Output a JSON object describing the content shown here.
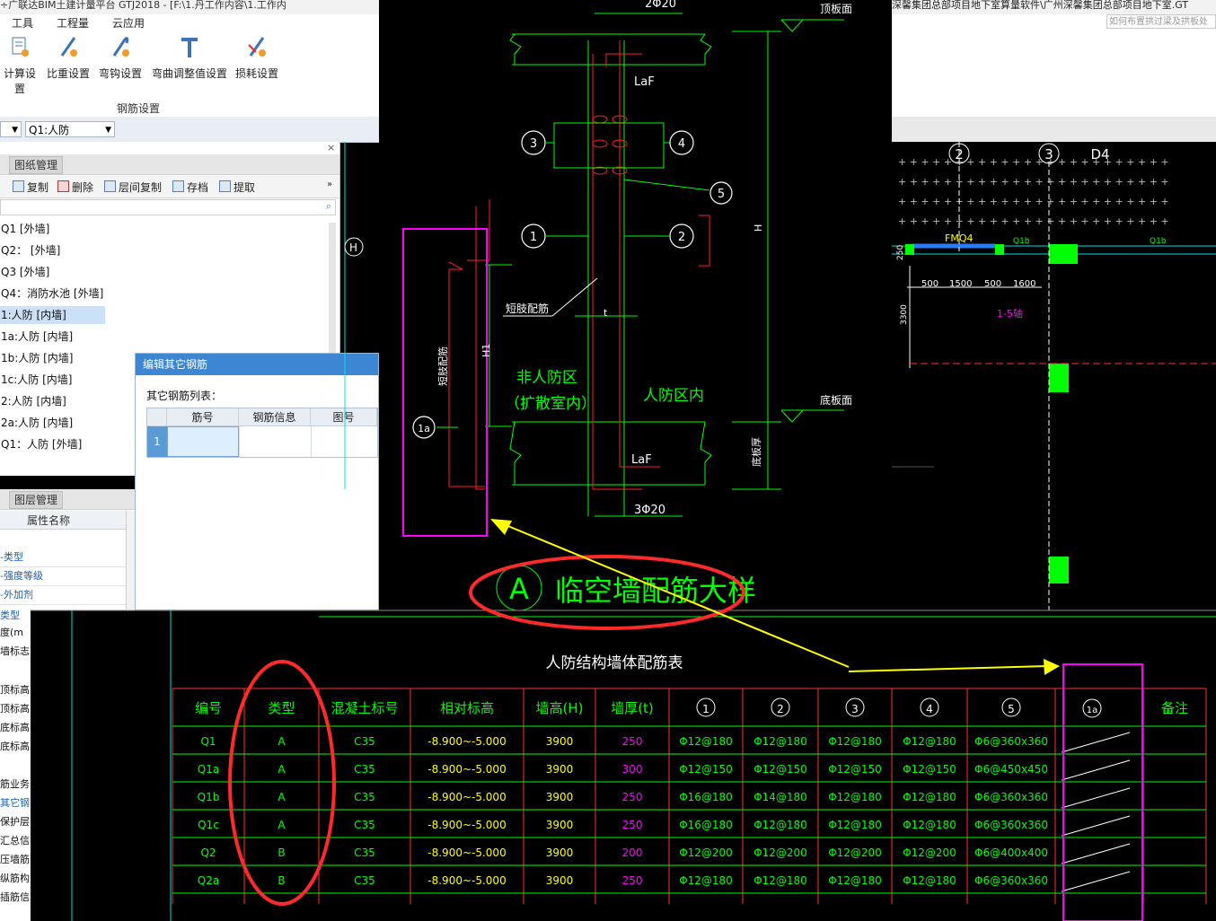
{
  "left_app": {
    "title": "÷广联达BIM土建计量平台 GTJ2018 - [F:\\1.丹工作内容\\1.工作内",
    "menu": [
      "工具",
      "工程量",
      "云应用"
    ],
    "ribbon_buttons": [
      "计算设置",
      "比重设置",
      "弯钩设置",
      "弯曲调整值设置",
      "损耗设置"
    ],
    "ribbon_group": "钢筋设置",
    "combo_value": "Q1:人防",
    "drawing_tab": "图纸管理",
    "tools": [
      "复制",
      "删除",
      "层间复制",
      "存档",
      "提取"
    ],
    "tree_items": [
      "Q1 [外墙]",
      "Q2： [外墙]",
      "Q3 [外墙]",
      "Q4：消防水池 [外墙]",
      "1:人防 [内墙]",
      "1a:人防 [内墙]",
      "1b:人防 [内墙]",
      "1c:人防 [内墙]",
      "2:人防 [内墙]",
      "2a:人防 [内墙]",
      "Q1：人防 [外墙]"
    ],
    "layer_tab": "图层管理",
    "prop_header": "属性名称",
    "prop_rows": [
      "-类型",
      "-强度等级",
      "-外加剂",
      "类型"
    ],
    "side_labels": [
      "度(m",
      "墙标志",
      "",
      "顶标高(",
      "顶标高(",
      "底标高(",
      "底标高(",
      "",
      "筋业务",
      "其它钢",
      "保护层",
      "汇总信",
      "压墙筋",
      "纵筋构",
      "插筋信"
    ]
  },
  "dialog": {
    "title": "编辑其它钢筋",
    "list_label": "其它钢筋列表：",
    "columns": [
      "筋号",
      "钢筋信息",
      "图号"
    ],
    "row_number": "1"
  },
  "right_app": {
    "title": "深馨集团总部项目地下室算量软件\\广州深馨集团总部项目地下室.GT",
    "search_placeholder": "如何布置拱过梁及拱板处"
  },
  "cad_detail": {
    "top_bar": "2Φ20",
    "bottom_bar": "3Φ20",
    "laf_top": "LaF",
    "laf_bottom": "LaF",
    "roof_label": "顶板面",
    "floor_label": "底板面",
    "short_bar": "短肢配筋",
    "left_rebar": "短肢配筋",
    "zone_non1": "非人防区",
    "zone_non2": "（扩散室内）",
    "zone_civil": "人防区内",
    "thickness": "t",
    "height": "H",
    "h1": "H1",
    "floor_thickness": "底板厚",
    "markers": [
      "1",
      "2",
      "3",
      "4",
      "5",
      "1a"
    ],
    "detail_letter": "A",
    "detail_title": "临空墙配筋大样"
  },
  "cad_plan": {
    "grid": [
      "2",
      "3",
      "D4"
    ],
    "door": "FMQ4",
    "q1b_1": "Q1b",
    "q1b_2": "Q1b",
    "dims": [
      "500",
      "1500",
      "500",
      "1600"
    ],
    "dim_250": "250",
    "dim_3300": "3300",
    "level": "1-5轴"
  },
  "table": {
    "title": "人防结构墙体配筋表",
    "headers": [
      "编号",
      "类型",
      "混凝土标号",
      "相对标高",
      "墙高(H)",
      "墙厚(t)",
      "1",
      "2",
      "3",
      "4",
      "5",
      "1a",
      "备注"
    ],
    "rows": [
      [
        "Q1",
        "A",
        "C35",
        "-8.900~-5.000",
        "3900",
        "250",
        "Φ12@180",
        "Φ12@180",
        "Φ12@180",
        "Φ12@180",
        "Φ6@360x360"
      ],
      [
        "Q1a",
        "A",
        "C35",
        "-8.900~-5.000",
        "3900",
        "300",
        "Φ12@150",
        "Φ12@150",
        "Φ12@150",
        "Φ12@150",
        "Φ6@450x450"
      ],
      [
        "Q1b",
        "A",
        "C35",
        "-8.900~-5.000",
        "3900",
        "250",
        "Φ16@180",
        "Φ14@180",
        "Φ12@180",
        "Φ12@180",
        "Φ6@360x360"
      ],
      [
        "Q1c",
        "A",
        "C35",
        "-8.900~-5.000",
        "3900",
        "250",
        "Φ16@180",
        "Φ12@180",
        "Φ12@180",
        "Φ12@180",
        "Φ6@360x360"
      ],
      [
        "Q2",
        "B",
        "C35",
        "-8.900~-5.000",
        "3900",
        "200",
        "Φ12@200",
        "Φ12@200",
        "Φ12@200",
        "Φ12@200",
        "Φ6@400x400"
      ],
      [
        "Q2a",
        "B",
        "C35",
        "-8.900~-5.000",
        "3900",
        "250",
        "Φ12@180",
        "Φ12@180",
        "Φ12@180",
        "Φ12@180",
        "Φ6@360x360"
      ]
    ]
  },
  "colors": {
    "cad_bg": "#000000",
    "cad_line": "#00ff00",
    "cad_red": "#ff2020",
    "cad_yellow": "#ffff00",
    "cad_magenta": "#ff00ff",
    "annotation_red": "#ff2a2a",
    "annotation_yellow": "#ffff00",
    "selection_blue": "#cce0f7",
    "dialog_title": "#3c86d3"
  }
}
